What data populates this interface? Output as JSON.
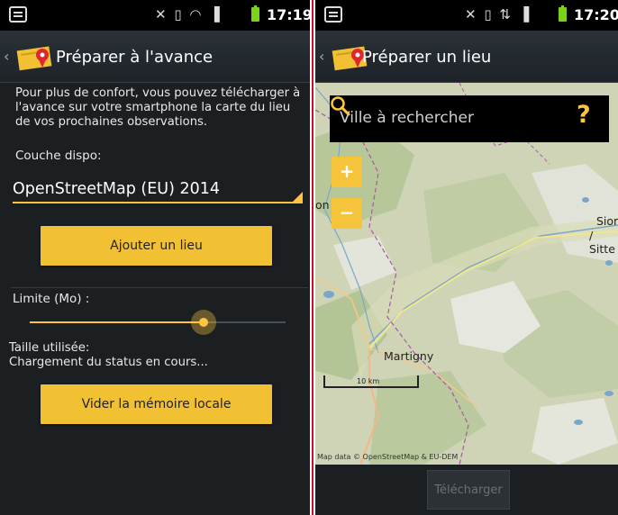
{
  "left": {
    "status_time": "17:19",
    "title": "Préparer à l'avance",
    "intro_text": "Pour plus de confort, vous pouvez télécharger à l'avance sur votre smartphone la carte du lieu de vos prochaines observations.",
    "couche_label": "Couche dispo:",
    "layer_selected": "OpenStreetMap (EU) 2014",
    "add_button": "Ajouter un lieu",
    "limit_label": "Limite (Mo) :",
    "limit_slider_fraction": 0.68,
    "size_label": "Taille utilisée:",
    "loading_status": "Chargement du status en cours...",
    "clear_button": "Vider la mémoire locale"
  },
  "right": {
    "status_time": "17:20",
    "title": "Préparer un lieu",
    "search_placeholder": "Ville à rechercher",
    "help_symbol": "?",
    "zoom_in": "+",
    "zoom_out": "−",
    "map_labels": {
      "martigny": "Martigny",
      "sion_1": "Sior",
      "sion_2": "/ Sitte",
      "left_edge": "on"
    },
    "scale_text": "10 km",
    "attribution": "Map data © OpenStreetMap & EU-DEM",
    "download_button": "Télécharger"
  },
  "colors": {
    "accent": "#f1c033",
    "background": "#1b1f22",
    "divider": "#c8102e",
    "battery": "#7ad21a"
  },
  "icons": [
    "notification-icon",
    "app-logo",
    "search-icon",
    "help-icon",
    "battery-icon",
    "wifi-icon",
    "signal-icon",
    "vibrate-icon"
  ]
}
